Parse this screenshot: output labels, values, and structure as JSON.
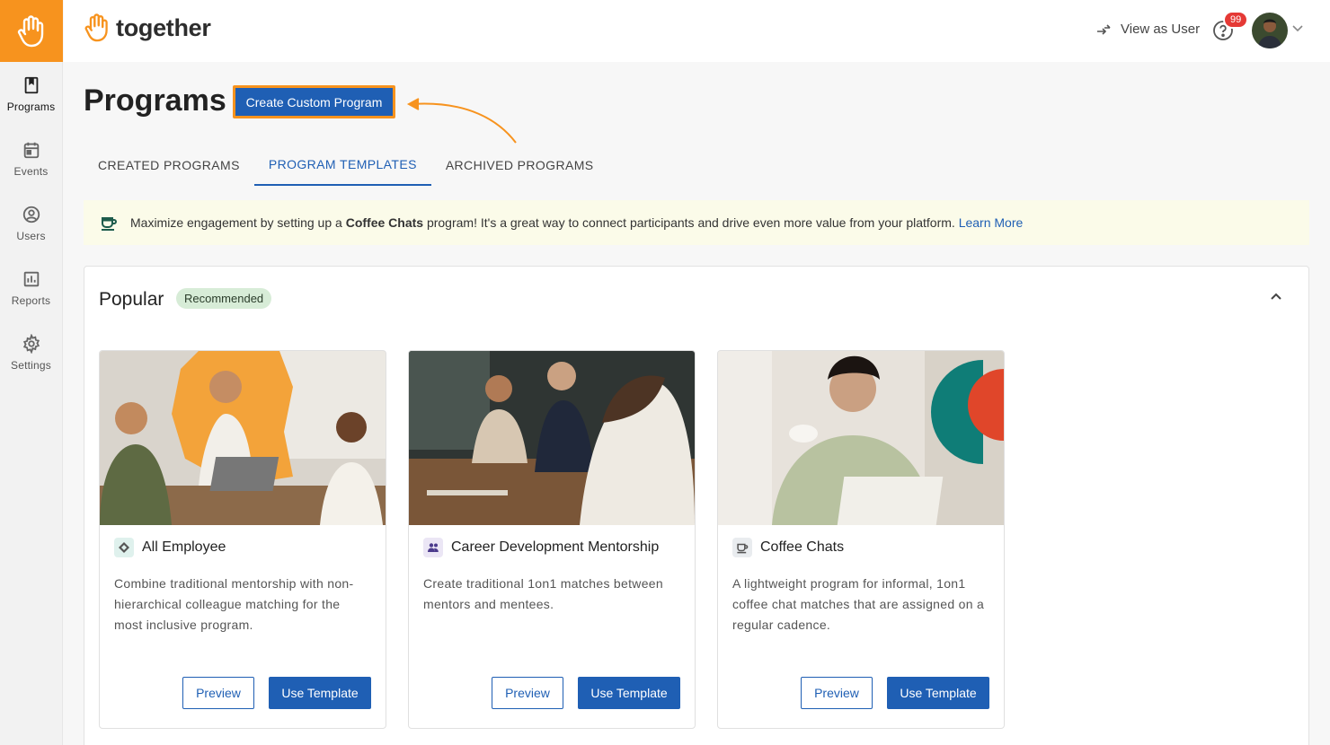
{
  "app": {
    "brand": "together"
  },
  "sidebar": {
    "items": [
      {
        "label": "Programs",
        "icon": "book-icon"
      },
      {
        "label": "Events",
        "icon": "calendar-icon"
      },
      {
        "label": "Users",
        "icon": "user-circle-icon"
      },
      {
        "label": "Reports",
        "icon": "bar-chart-icon"
      },
      {
        "label": "Settings",
        "icon": "gear-icon"
      }
    ]
  },
  "header": {
    "view_as_user": "View as User",
    "notification_count": "99"
  },
  "page": {
    "title": "Programs",
    "create_button": "Create Custom Program"
  },
  "tabs": [
    {
      "label": "CREATED PROGRAMS",
      "active": false
    },
    {
      "label": "PROGRAM TEMPLATES",
      "active": true
    },
    {
      "label": "ARCHIVED PROGRAMS",
      "active": false
    }
  ],
  "banner": {
    "text_before": "Maximize engagement by setting up a ",
    "bold": "Coffee Chats",
    "text_after": " program! It's a great way to connect participants and drive even more value from your platform. ",
    "link": "Learn More"
  },
  "section": {
    "title": "Popular",
    "badge": "Recommended"
  },
  "cards": [
    {
      "title": "All Employee",
      "icon": "diamond-icon",
      "description": "Combine traditional mentorship with non-hierarchical colleague matching for the most inclusive program.",
      "preview": "Preview",
      "use": "Use Template"
    },
    {
      "title": "Career Development Mentorship",
      "icon": "people-icon",
      "description": "Create traditional 1on1 matches between mentors and mentees.",
      "preview": "Preview",
      "use": "Use Template"
    },
    {
      "title": "Coffee Chats",
      "icon": "coffee-icon",
      "description": "A lightweight program for informal, 1on1 coffee chat matches that are assigned on a regular cadence.",
      "preview": "Preview",
      "use": "Use Template"
    }
  ],
  "colors": {
    "accent": "#1f5fb4",
    "brand_orange": "#f7931e",
    "banner_bg": "#fbfbe9",
    "badge_bg": "#d7ecd7"
  }
}
